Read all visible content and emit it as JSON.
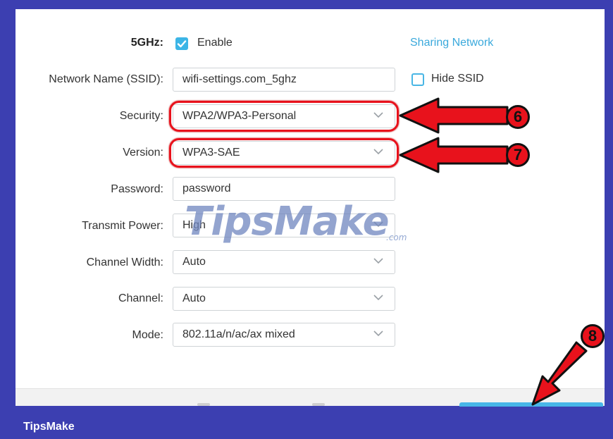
{
  "band": {
    "label": "5GHz:",
    "enable_label": "Enable",
    "enable_checked": true,
    "sharing_link": "Sharing Network"
  },
  "fields": {
    "ssid": {
      "label": "Network Name (SSID):",
      "value": "wifi-settings.com_5ghz"
    },
    "hide_ssid": {
      "label": "Hide SSID",
      "checked": false
    },
    "security": {
      "label": "Security:",
      "value": "WPA2/WPA3-Personal"
    },
    "version": {
      "label": "Version:",
      "value": "WPA3-SAE"
    },
    "password": {
      "label": "Password:",
      "value": "password"
    },
    "transmit_power": {
      "label": "Transmit Power:",
      "value": "High"
    },
    "channel_width": {
      "label": "Channel Width:",
      "value": "Auto"
    },
    "channel": {
      "label": "Channel:",
      "value": "Auto"
    },
    "mode": {
      "label": "Mode:",
      "value": "802.11a/n/ac/ax mixed"
    }
  },
  "annotations": {
    "step6": "6",
    "step7": "7",
    "step8": "8"
  },
  "watermark": {
    "main": "TipsMake",
    "suffix": ".com"
  },
  "footer": {
    "brand": "TipsMake"
  },
  "colors": {
    "frame": "#3c3fb1",
    "accent": "#3cb5e6",
    "highlight": "#e8121c",
    "link": "#3aa9dc"
  },
  "icons": {
    "chevron": "chevron-down-icon",
    "check": "check-icon",
    "arrow": "arrow-pointer-icon"
  }
}
